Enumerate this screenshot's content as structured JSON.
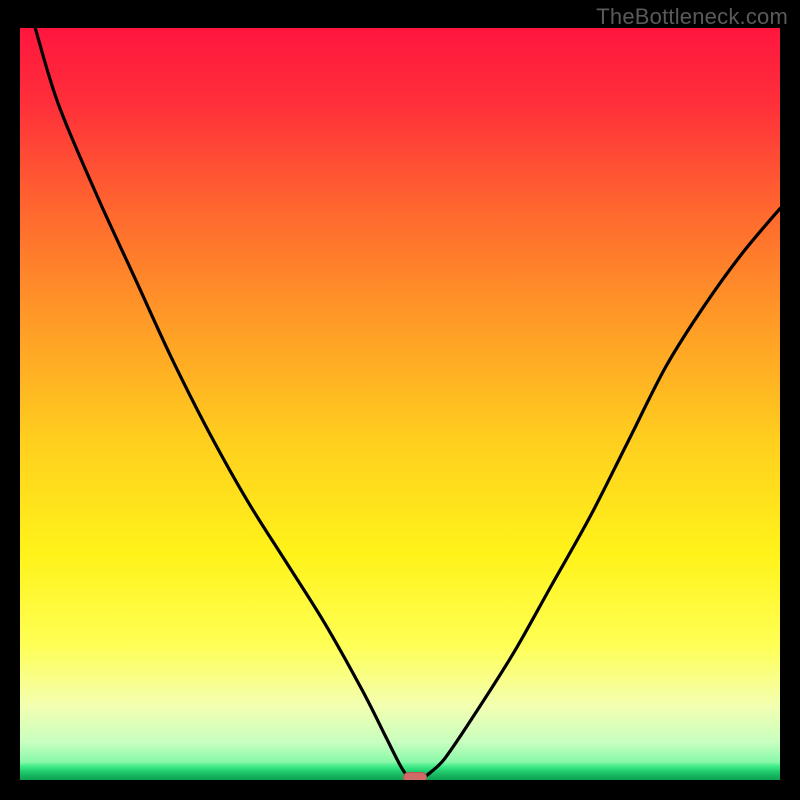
{
  "watermark": "TheBottleneck.com",
  "colors": {
    "frame": "#000000",
    "watermark": "#5a5a5a",
    "curve": "#000000",
    "marker": "#cf6a66",
    "gradient_stops": [
      "#ff1a3c",
      "#ff5a2a",
      "#ffa726",
      "#ffd21a",
      "#ffff1a",
      "#f6ffa0",
      "#9effb0",
      "#20c86c"
    ]
  },
  "chart_data": {
    "type": "line",
    "title": "",
    "xlabel": "",
    "ylabel": "",
    "xlim": [
      0,
      100
    ],
    "ylim": [
      0,
      100
    ],
    "optimum_x": 52,
    "marker": {
      "x": 52,
      "y": 0
    },
    "x": [
      2,
      5,
      10,
      15,
      20,
      25,
      30,
      35,
      40,
      45,
      48,
      50,
      51,
      52,
      53,
      54,
      56,
      60,
      65,
      70,
      75,
      80,
      85,
      90,
      95,
      100
    ],
    "values": [
      100,
      90,
      78,
      67,
      56,
      46,
      37,
      29,
      21,
      12,
      6,
      2,
      0.5,
      0,
      0.3,
      1,
      3,
      9,
      17,
      26,
      35,
      45,
      55,
      63,
      70,
      76
    ],
    "note": "Values are percent bottleneck (y) vs component balance axis (x); curve reaches 0 at x≈52 and rises on both sides."
  }
}
